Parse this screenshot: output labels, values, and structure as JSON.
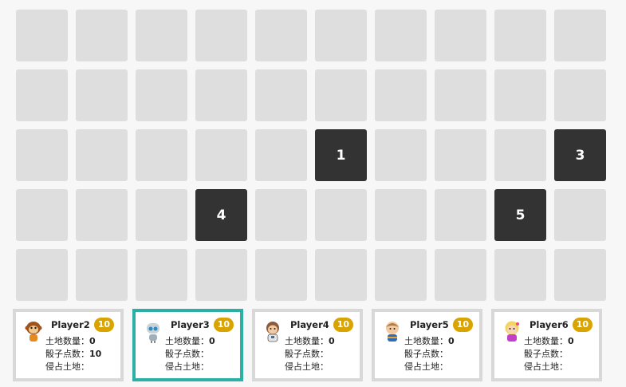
{
  "board": {
    "cols": 10,
    "rows": 5,
    "occupied": [
      {
        "row": 2,
        "col": 5,
        "label": "1"
      },
      {
        "row": 2,
        "col": 9,
        "label": "3"
      },
      {
        "row": 3,
        "col": 3,
        "label": "4"
      },
      {
        "row": 3,
        "col": 8,
        "label": "5"
      }
    ]
  },
  "labels": {
    "land_count": "土地数量：",
    "dice_points": "骰子点数：",
    "occupied_land": "侵占土地："
  },
  "players": [
    {
      "name": "Player2",
      "coins": "10",
      "land_count": "0",
      "dice_points": "10",
      "occupied_land": "",
      "avatar": "monkey-avatar-icon",
      "active": false
    },
    {
      "name": "Player3",
      "coins": "10",
      "land_count": "0",
      "dice_points": "",
      "occupied_land": "",
      "avatar": "robot-avatar-icon",
      "active": true
    },
    {
      "name": "Player4",
      "coins": "10",
      "land_count": "0",
      "dice_points": "",
      "occupied_land": "",
      "avatar": "astronaut-boy-avatar-icon",
      "active": false
    },
    {
      "name": "Player5",
      "coins": "10",
      "land_count": "0",
      "dice_points": "",
      "occupied_land": "",
      "avatar": "boy-avatar-icon",
      "active": false
    },
    {
      "name": "Player6",
      "coins": "10",
      "land_count": "0",
      "dice_points": "",
      "occupied_land": "",
      "avatar": "girl-avatar-icon",
      "active": false
    }
  ],
  "colors": {
    "cell": "#dedede",
    "occupied_cell": "#333333",
    "coin": "#d9a400",
    "active_border": "#2bb0a6",
    "card_border": "#d8d8d8"
  }
}
